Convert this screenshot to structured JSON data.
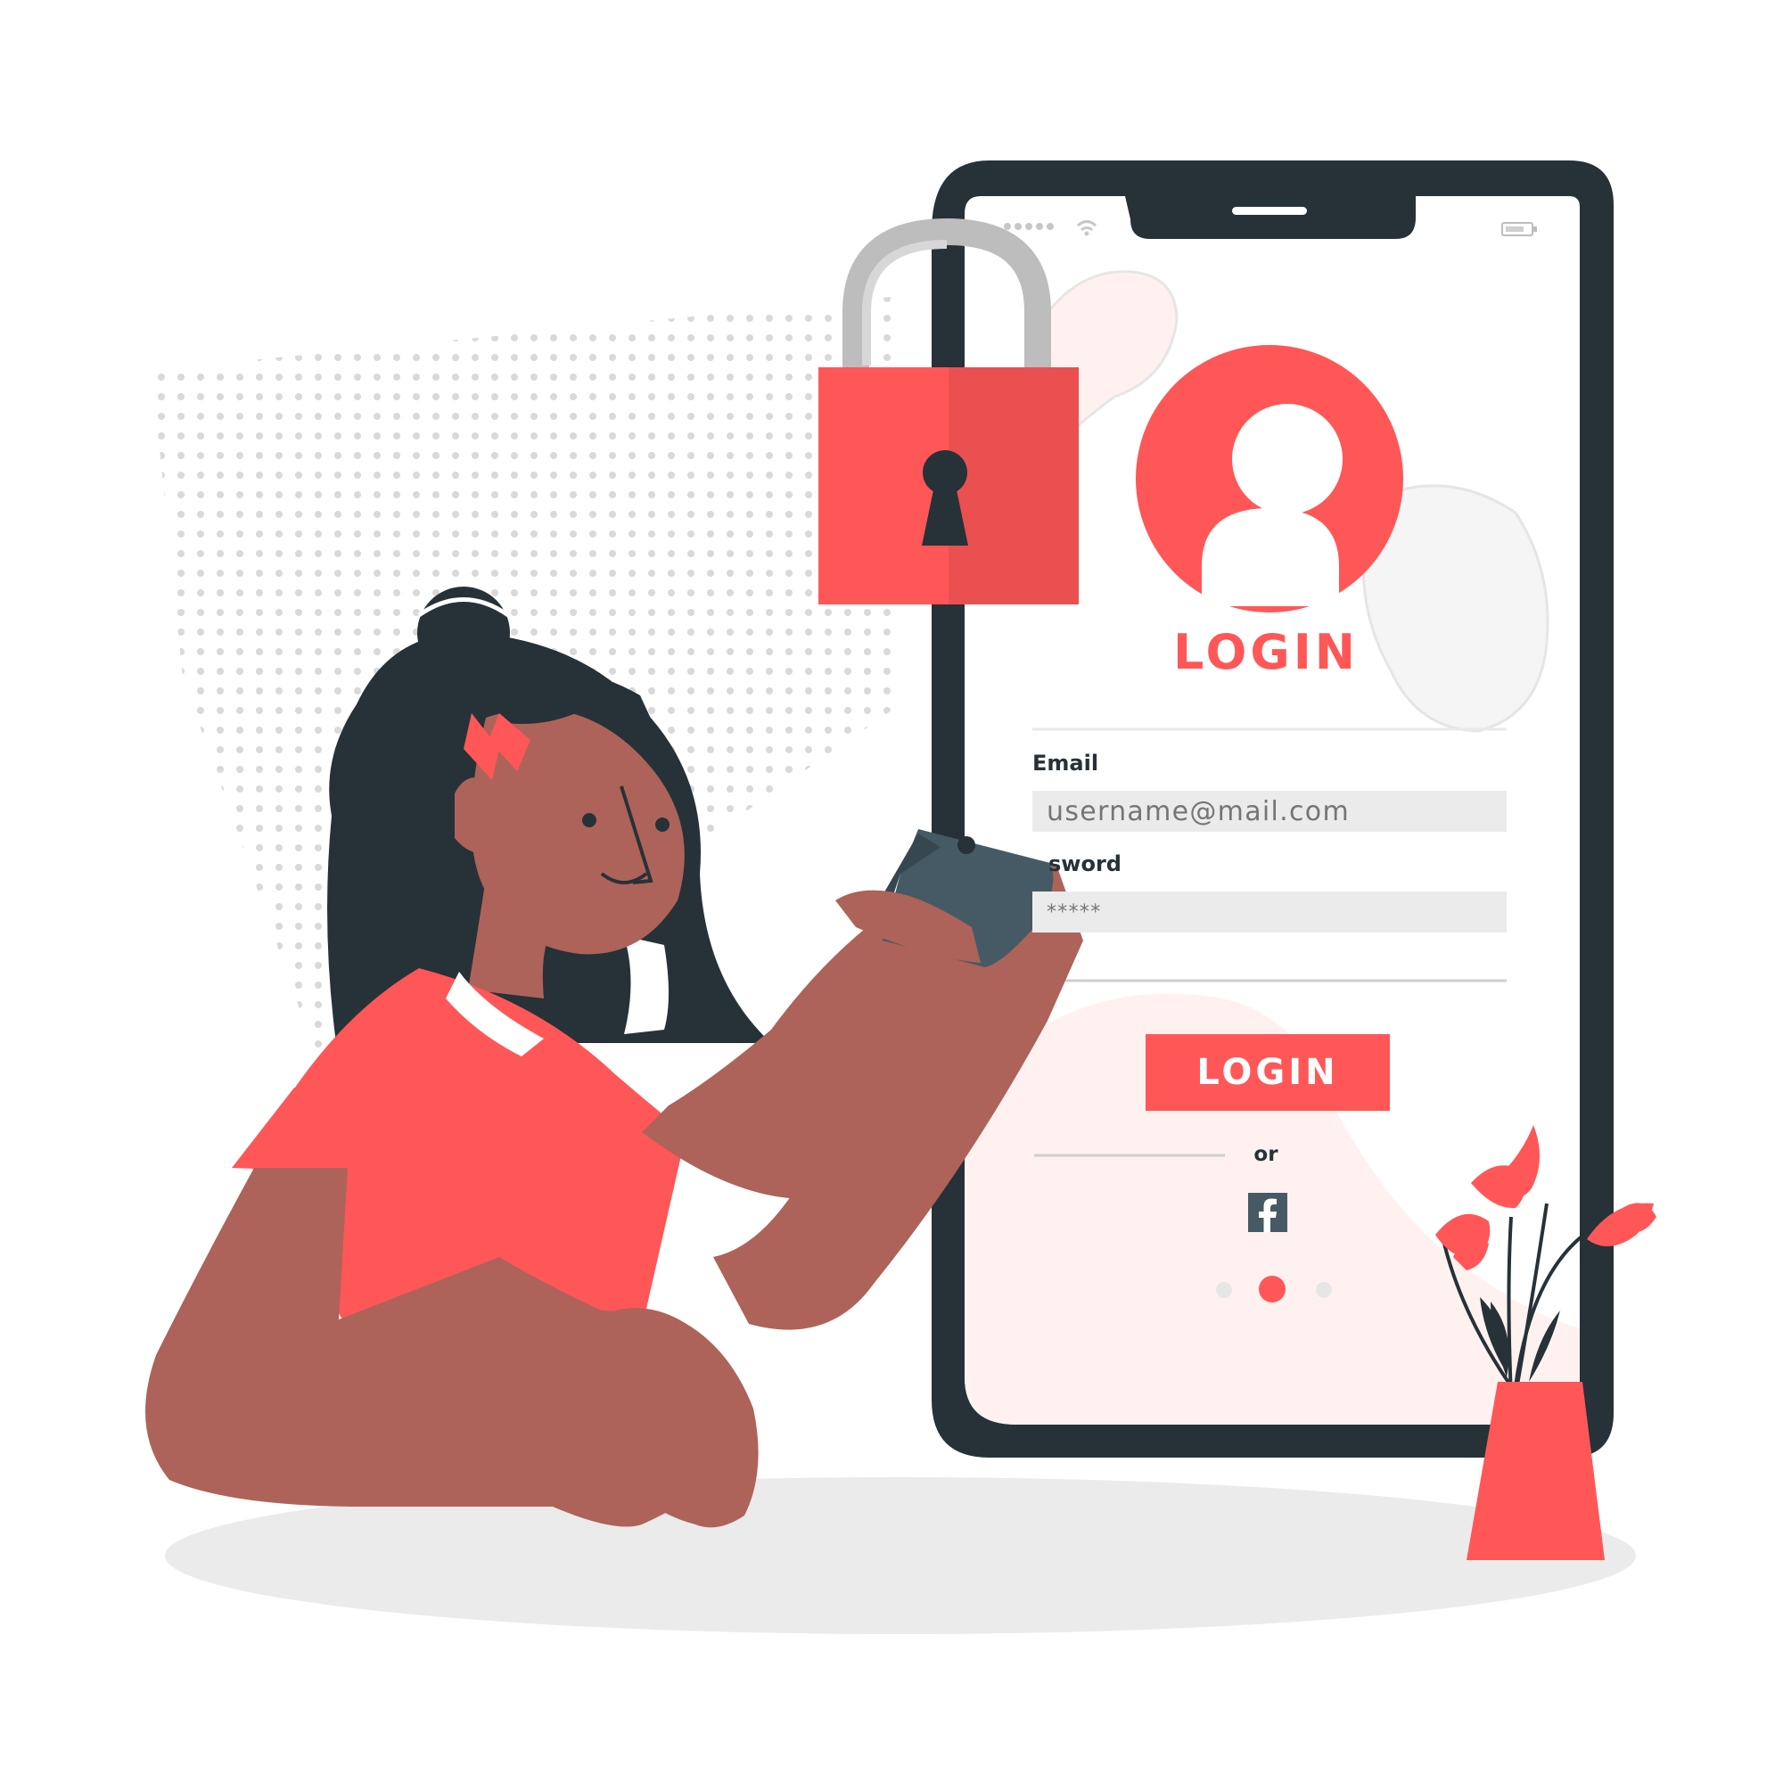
{
  "title": "LOGIN",
  "form": {
    "email_label": "Email",
    "email_placeholder": "username@mail.com",
    "password_label": "sword",
    "password_placeholder": "*****",
    "login_button": "LOGIN",
    "separator": "or"
  },
  "icons": {
    "padlock": "padlock-icon",
    "user": "user-avatar-icon",
    "social": "facebook-icon",
    "wifi": "wifi-icon",
    "battery": "battery-icon"
  },
  "carousel": {
    "dots": 3,
    "active_index": 1
  },
  "colors": {
    "accent": "#ff5757",
    "dark": "#263238",
    "skin": "#ad6359",
    "gray": "#ebebeb"
  }
}
